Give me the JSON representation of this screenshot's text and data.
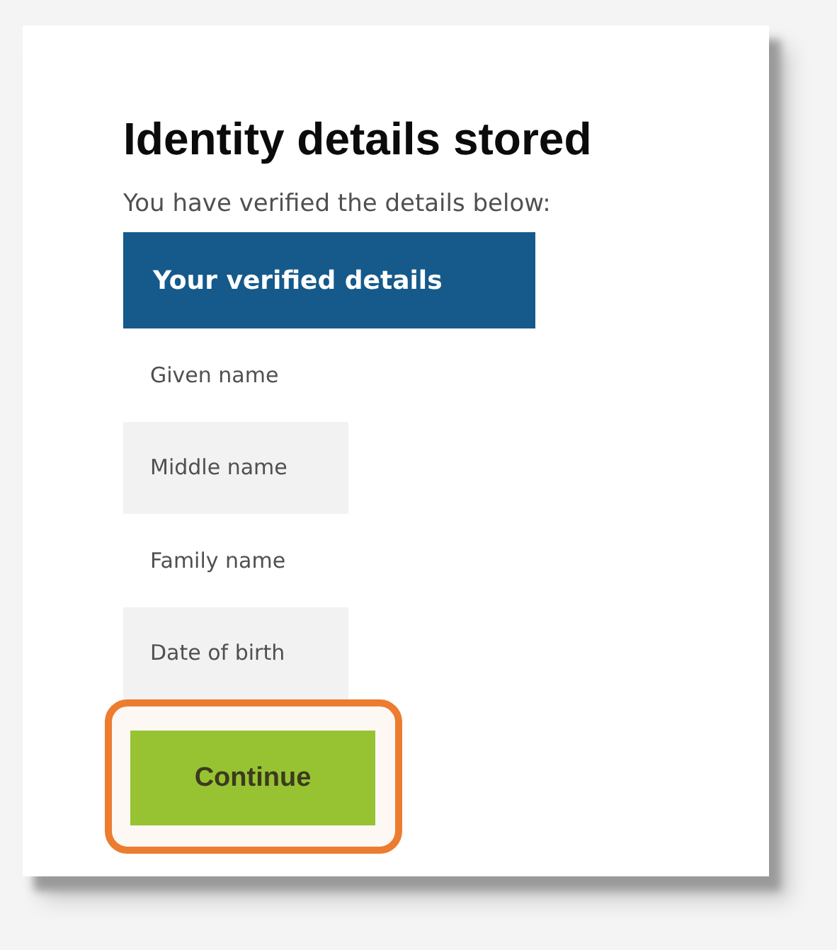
{
  "title": "Identity details stored",
  "intro": "You have verified the details below:",
  "details": {
    "heading": "Your verified details",
    "rows": [
      {
        "label": "Given name"
      },
      {
        "label": "Middle name"
      },
      {
        "label": "Family name"
      },
      {
        "label": "Date of birth"
      }
    ]
  },
  "button": {
    "label": "Continue",
    "highlighted": true
  }
}
